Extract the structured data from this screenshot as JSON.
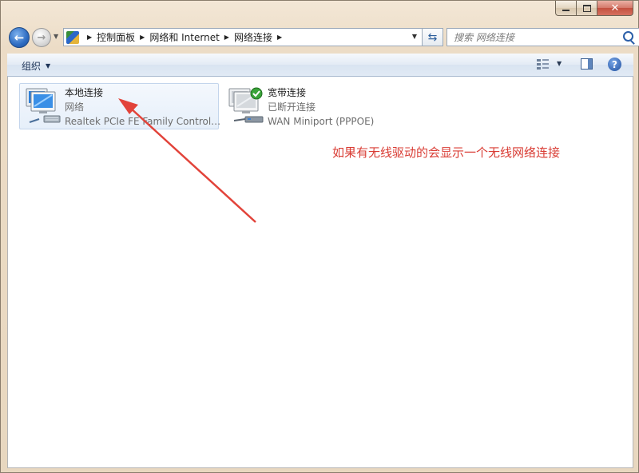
{
  "nav": {
    "breadcrumbs": [
      "控制面板",
      "网络和 Internet",
      "网络连接"
    ],
    "search_placeholder": "搜索 网络连接"
  },
  "toolbar": {
    "organize_label": "组织"
  },
  "connections": [
    {
      "name": "本地连接",
      "status": "网络",
      "adapter": "Realtek PCIe FE Family Control…",
      "selected": true
    },
    {
      "name": "宽带连接",
      "status": "已断开连接",
      "adapter": "WAN Miniport (PPPOE)",
      "selected": false
    }
  ],
  "annotation": {
    "text": "如果有无线驱动的会显示一个无线网络连接",
    "color": "#d93c34"
  },
  "colors": {
    "selection": "#e6effa",
    "annotation": "#d93c34",
    "connected_badge": "#3aa33a"
  }
}
